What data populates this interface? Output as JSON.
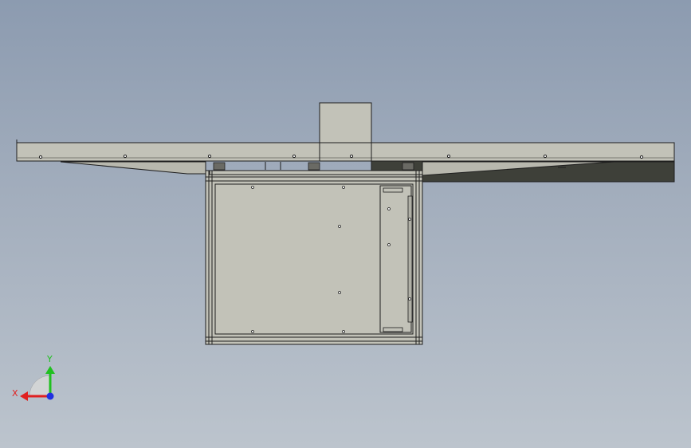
{
  "viewport": {
    "background_top": "#8c9bb0",
    "background_bottom": "#bcc4cd",
    "model_fill": "#c2c2b8",
    "model_shadow": "#3e4039",
    "edge_color": "#1e1e1e"
  },
  "triad": {
    "x_label": "X",
    "y_label": "Y",
    "x_color": "#e02020",
    "y_color": "#20c020",
    "z_color": "#2030e0"
  }
}
